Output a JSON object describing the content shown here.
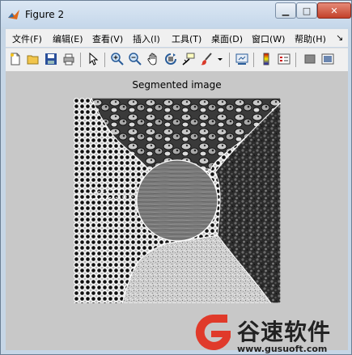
{
  "window": {
    "title": "Figure 2"
  },
  "menu": [
    {
      "label": "文件(F)"
    },
    {
      "label": "编辑(E)"
    },
    {
      "label": "查看(V)"
    },
    {
      "label": "插入(I)"
    },
    {
      "label": "工具(T)"
    },
    {
      "label": "桌面(D)"
    },
    {
      "label": "窗口(W)"
    },
    {
      "label": "帮助(H)"
    },
    {
      "label": "↘"
    }
  ],
  "toolbar_icons": [
    "new-figure-icon",
    "open-icon",
    "save-icon",
    "print-icon",
    "pointer-icon",
    "zoom-in-icon",
    "zoom-out-icon",
    "pan-icon",
    "rotate-3d-icon",
    "data-cursor-icon",
    "brush-icon",
    "brush-dropdown-icon",
    "link-plot-icon",
    "colorbar-icon",
    "legend-icon",
    "hide-plot-tools-icon",
    "show-plot-tools-icon"
  ],
  "figure": {
    "title": "Segmented image"
  },
  "watermark": {
    "brand": "谷速软件",
    "url": "www.gusuoft.com"
  },
  "colors": {
    "canvas": "#c8c8c8",
    "brand": "#e03a2a"
  }
}
